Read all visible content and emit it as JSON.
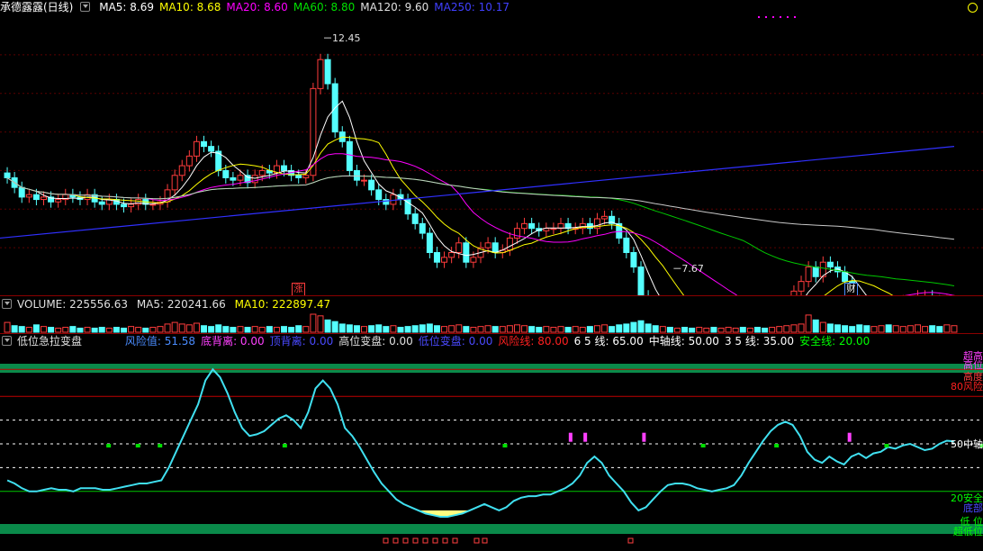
{
  "colors": {
    "up": "#ff3c3c",
    "down": "#54ffff",
    "ma5": "#ffffff",
    "ma10": "#ffff00",
    "ma20": "#ff00ff",
    "ma60": "#00c800",
    "ma120": "#c8c8c8",
    "ma250": "#3030ff",
    "risk": "#ff2020",
    "safe": "#00ff00",
    "osc": "#40e0f0"
  },
  "price_panel": {
    "title": "承德露露(日线)",
    "ma": [
      {
        "label": "MA5: 8.69",
        "color": "#ffffff"
      },
      {
        "label": "MA10: 8.68",
        "color": "#ffff00"
      },
      {
        "label": "MA20: 8.60",
        "color": "#ff00ff"
      },
      {
        "label": "MA60: 8.80",
        "color": "#00e000"
      },
      {
        "label": "MA120: 9.60",
        "color": "#e0e0e0"
      },
      {
        "label": "MA250: 10.17",
        "color": "#4040ff"
      }
    ],
    "high_label": "12.45",
    "low_label": "7.67",
    "badge_zhang": "涨",
    "badge_cai": "财"
  },
  "volume_panel": {
    "title": "VOLUME: 225556.63",
    "ma5": "MA5: 220241.66",
    "ma10": "MA10: 222897.47"
  },
  "indicator_panel": {
    "title": "低位急拉变盘",
    "items": [
      {
        "label": "风险值: 51.58",
        "color": "#4a8cff"
      },
      {
        "label": "底背离: 0.00",
        "color": "#ff40ff"
      },
      {
        "label": "顶背离: 0.00",
        "color": "#4a4aff"
      },
      {
        "label": "高位变盘: 0.00",
        "color": "#e0e0e0"
      },
      {
        "label": "低位变盘: 0.00",
        "color": "#4a4aff"
      },
      {
        "label": "风险线: 80.00",
        "color": "#ff2020"
      },
      {
        "label": "6 5 线: 65.00",
        "color": "#ffffff"
      },
      {
        "label": "中轴线: 50.00",
        "color": "#ffffff"
      },
      {
        "label": "3 5 线: 35.00",
        "color": "#ffffff"
      },
      {
        "label": "安全线: 20.00",
        "color": "#00ff00"
      }
    ],
    "right_labels": [
      {
        "text": "超高",
        "color": "#ff40ff"
      },
      {
        "text": "高位",
        "color": "#ff40ff"
      },
      {
        "text": "高度",
        "color": "#ff4040"
      },
      {
        "text": "80风险",
        "color": "#ff2020"
      },
      {
        "text": "50中轴",
        "color": "#ffffff"
      },
      {
        "text": "20安全",
        "color": "#00ff00"
      },
      {
        "text": "底部",
        "color": "#4a4aff"
      },
      {
        "text": "低 位",
        "color": "#00ff00"
      },
      {
        "text": "超低位",
        "color": "#00ff00"
      }
    ]
  },
  "chart_data": [
    {
      "type": "candlestick",
      "title": "承德露露(日线)",
      "ylim": [
        7.3,
        12.9
      ],
      "annotations": [
        {
          "text": "12.45",
          "value": 12.45
        },
        {
          "text": "7.67",
          "value": 7.67
        }
      ],
      "close": [
        9.55,
        9.35,
        9.15,
        9.2,
        9.1,
        9.15,
        9.05,
        9.1,
        9.2,
        9.15,
        9.1,
        9.2,
        9.05,
        9.0,
        9.1,
        9.0,
        8.95,
        9.0,
        9.1,
        9.0,
        9.0,
        9.05,
        9.3,
        9.6,
        9.8,
        10.0,
        10.3,
        10.2,
        10.1,
        9.7,
        9.55,
        9.5,
        9.6,
        9.45,
        9.6,
        9.7,
        9.65,
        9.8,
        9.7,
        9.6,
        9.55,
        9.6,
        11.4,
        12.0,
        11.5,
        10.5,
        10.3,
        9.7,
        9.5,
        9.5,
        9.3,
        9.1,
        9.0,
        9.2,
        9.1,
        8.8,
        8.6,
        8.4,
        8.0,
        7.8,
        7.9,
        8.0,
        8.2,
        7.8,
        7.9,
        8.1,
        8.2,
        8.0,
        8.05,
        8.3,
        8.5,
        8.6,
        8.5,
        8.45,
        8.5,
        8.5,
        8.6,
        8.5,
        8.5,
        8.6,
        8.5,
        8.7,
        8.75,
        8.6,
        8.3,
        8.0,
        7.7,
        7.1,
        6.8,
        6.6,
        6.7,
        6.5,
        6.6,
        6.55,
        6.5,
        6.5,
        6.55,
        6.5,
        6.5,
        6.55,
        6.6,
        6.5,
        6.6,
        6.55,
        6.5,
        6.6,
        6.7,
        6.9,
        7.2,
        7.4,
        7.7,
        7.5,
        7.8,
        7.7,
        7.6,
        7.4,
        7.0,
        6.8,
        6.7,
        6.9,
        6.9,
        6.8,
        6.9,
        7.0,
        7.0,
        7.1,
        7.1,
        7.0,
        6.9,
        7.0,
        7.0
      ]
    },
    {
      "type": "bar",
      "title": "VOLUME: 225556.63",
      "values": [
        1.2,
        0.8,
        0.7,
        0.6,
        0.9,
        0.7,
        0.6,
        0.5,
        0.6,
        0.7,
        0.5,
        0.6,
        0.5,
        0.6,
        0.5,
        0.6,
        0.5,
        0.7,
        0.6,
        0.5,
        0.6,
        0.7,
        1.0,
        1.2,
        1.0,
        0.9,
        1.1,
        0.8,
        0.7,
        0.9,
        0.7,
        0.6,
        0.7,
        0.6,
        0.7,
        0.6,
        0.7,
        0.6,
        0.7,
        0.6,
        0.8,
        0.7,
        2.2,
        2.0,
        1.5,
        1.3,
        1.0,
        0.9,
        0.8,
        0.7,
        0.8,
        0.9,
        0.7,
        0.8,
        0.6,
        0.7,
        0.8,
        0.9,
        1.0,
        0.8,
        0.7,
        0.8,
        0.9,
        0.7,
        0.6,
        0.7,
        0.8,
        0.7,
        0.7,
        0.8,
        0.9,
        0.8,
        0.7,
        0.6,
        0.7,
        0.6,
        0.7,
        0.6,
        0.7,
        0.6,
        0.7,
        0.8,
        0.9,
        0.7,
        0.9,
        1.0,
        1.2,
        1.4,
        1.0,
        0.8,
        0.7,
        0.6,
        0.5,
        0.6,
        0.5,
        0.6,
        0.5,
        0.6,
        0.5,
        0.6,
        0.5,
        0.6,
        0.5,
        0.6,
        0.5,
        0.6,
        0.7,
        0.8,
        0.9,
        1.0,
        2.1,
        1.5,
        1.2,
        1.0,
        0.9,
        0.8,
        0.7,
        0.9,
        0.8,
        0.7,
        0.8,
        0.9,
        0.8,
        0.7,
        0.8,
        0.9,
        0.7,
        0.8,
        0.7,
        0.9,
        0.8
      ]
    },
    {
      "type": "line",
      "title": "低位急拉变盘",
      "ylim": [
        0,
        100
      ],
      "reference_lines": [
        80,
        65,
        50,
        35,
        20
      ],
      "series": [
        {
          "name": "风险值",
          "values": [
            27,
            25,
            22,
            20,
            20,
            21,
            22,
            21,
            21,
            20,
            22,
            22,
            22,
            21,
            21,
            22,
            23,
            24,
            25,
            25,
            26,
            27,
            35,
            45,
            55,
            65,
            75,
            90,
            97,
            92,
            82,
            70,
            60,
            55,
            56,
            58,
            62,
            66,
            68,
            65,
            60,
            70,
            85,
            90,
            85,
            75,
            60,
            55,
            48,
            40,
            32,
            25,
            20,
            15,
            12,
            10,
            8,
            6,
            5,
            4,
            4,
            5,
            6,
            8,
            10,
            12,
            10,
            8,
            10,
            14,
            16,
            17,
            17,
            18,
            18,
            20,
            22,
            25,
            30,
            38,
            42,
            38,
            30,
            25,
            20,
            13,
            8,
            10,
            15,
            20,
            24,
            25,
            25,
            24,
            22,
            21,
            20,
            21,
            22,
            24,
            30,
            38,
            45,
            52,
            58,
            62,
            64,
            62,
            55,
            45,
            40,
            38,
            42,
            39,
            37,
            42,
            44,
            41,
            44,
            45,
            48,
            47,
            49,
            50,
            48,
            46,
            47,
            50,
            52,
            51.58
          ]
        }
      ]
    }
  ]
}
